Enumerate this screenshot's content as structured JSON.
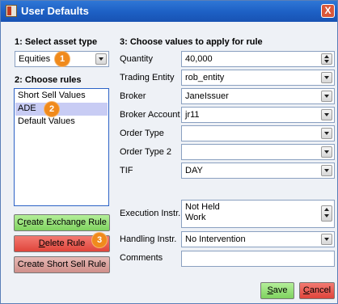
{
  "window": {
    "title": "User Defaults",
    "close_label": "X"
  },
  "asset": {
    "heading": "1: Select asset type",
    "selected": "Equities",
    "badge": "1"
  },
  "rules": {
    "heading": "2: Choose rules",
    "items": [
      "Short Sell Values",
      "ADE",
      "Default Values"
    ],
    "selected_index": 1,
    "badge": "2"
  },
  "buttons": {
    "create_exchange": {
      "prefix": "C",
      "accel": "r",
      "rest": "eate Exchange Rule"
    },
    "delete_rule": {
      "accel": "D",
      "rest": "elete Rule"
    },
    "delete_badge": "3",
    "create_short": "Create Short Sell Rule",
    "save": {
      "accel": "S",
      "rest": "ave"
    },
    "cancel": {
      "accel": "C",
      "rest": "ancel"
    }
  },
  "values": {
    "heading": "3: Choose values to apply for rule",
    "quantity": {
      "label": "Quantity",
      "value": "40,000"
    },
    "trading_entity": {
      "label": "Trading Entity",
      "value": "rob_entity"
    },
    "broker": {
      "label": "Broker",
      "value": "JaneIssuer"
    },
    "broker_account": {
      "label": "Broker Account",
      "value": "jr11"
    },
    "order_type": {
      "label": "Order Type",
      "value": ""
    },
    "order_type_2": {
      "label": "Order Type 2",
      "value": ""
    },
    "tif": {
      "label": "TIF",
      "value": "DAY"
    },
    "execution_instr": {
      "label": "Execution Instr.",
      "lines": [
        "Not Held",
        "Work"
      ]
    },
    "handling_instr": {
      "label": "Handling Instr.",
      "value": "No Intervention"
    },
    "comments": {
      "label": "Comments",
      "value": ""
    }
  },
  "colors": {
    "titlebar": "#1d5fc4",
    "badge": "#f08a1c",
    "create_exchange_button": "#7fd25f",
    "delete_button": "#e0453b",
    "create_short_button": "#cf8f8a"
  }
}
